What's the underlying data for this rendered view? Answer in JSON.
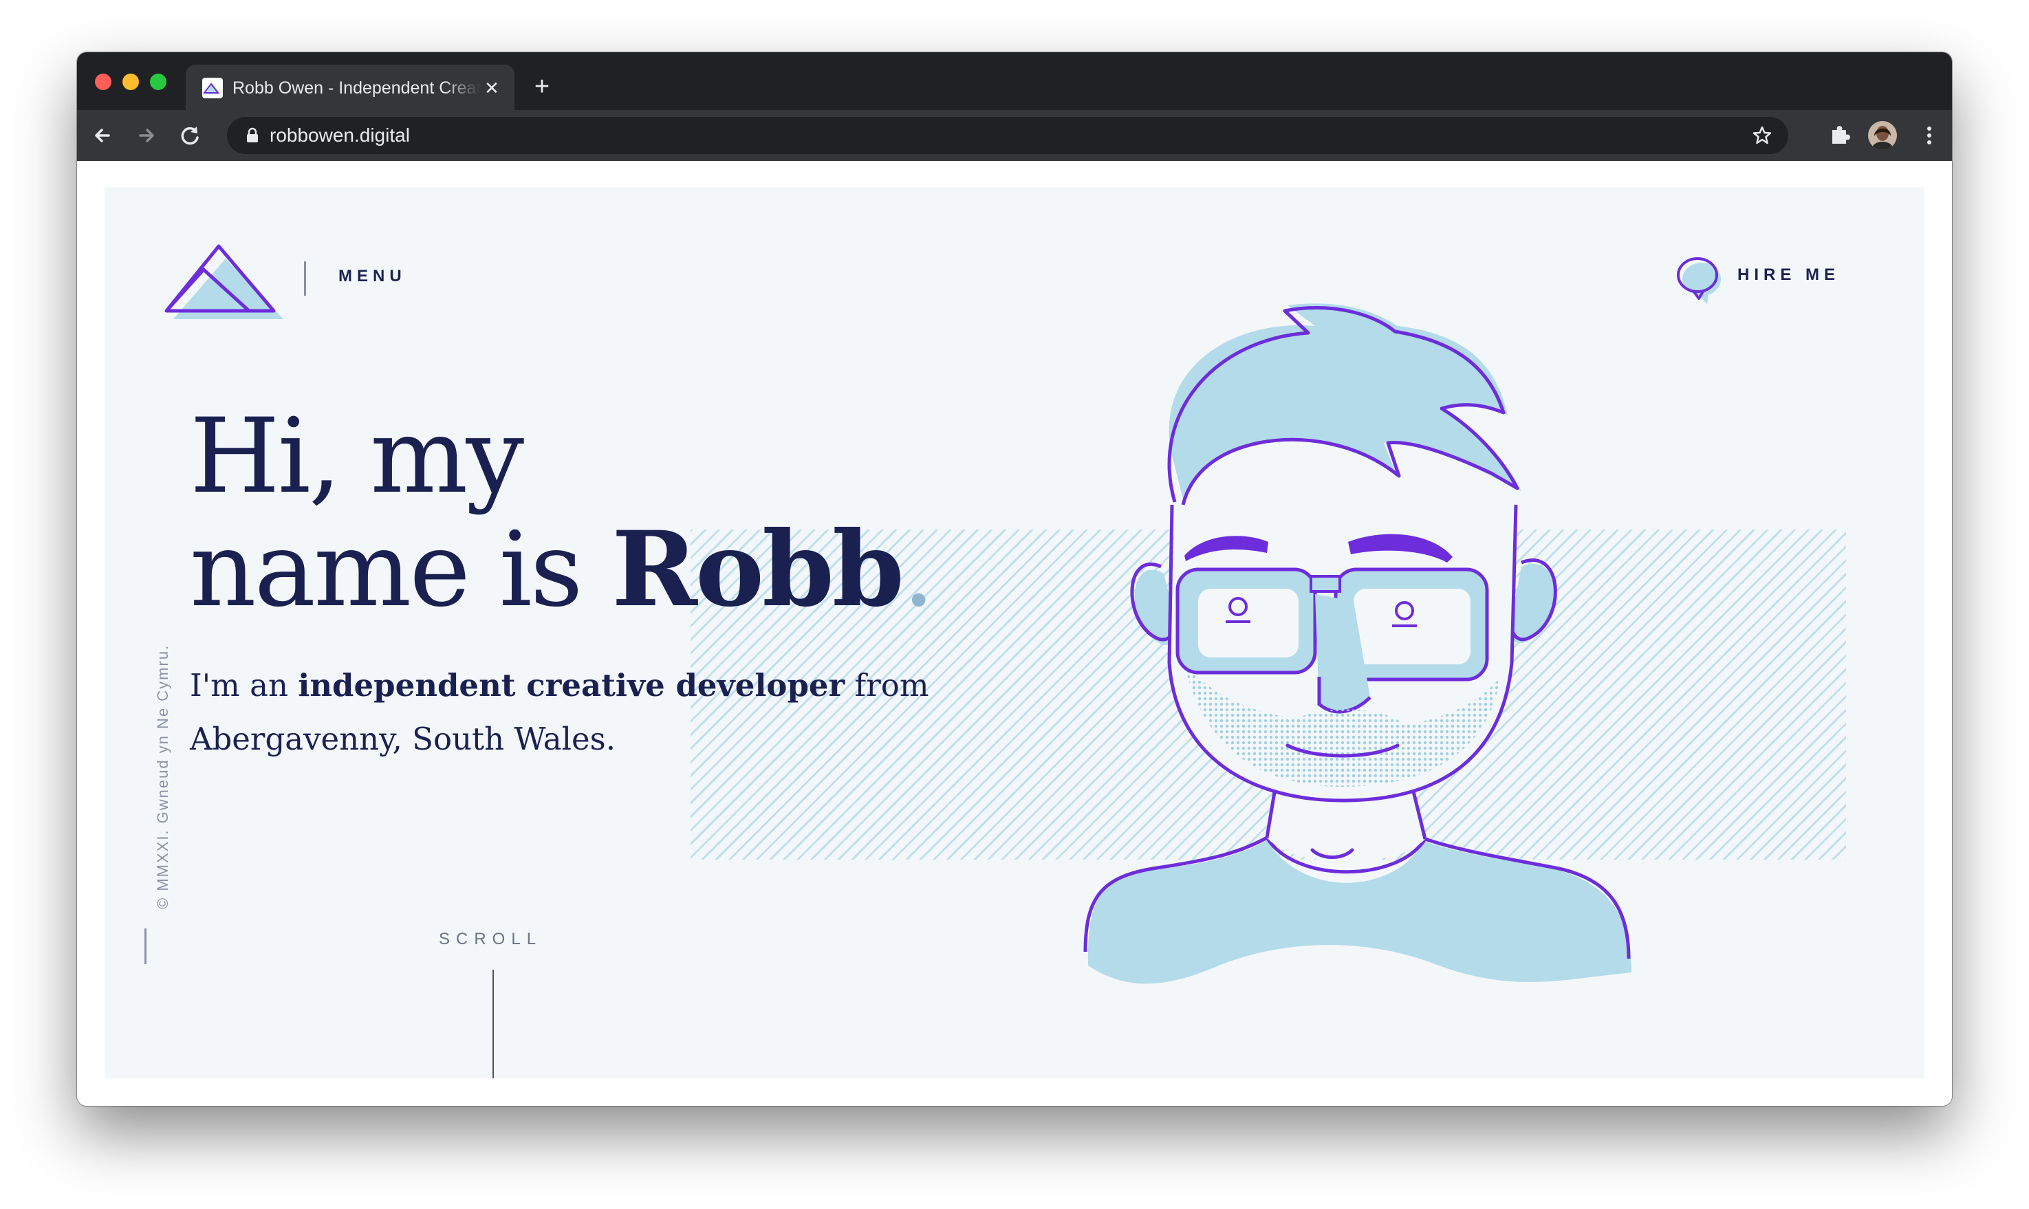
{
  "browser": {
    "tab_title": "Robb Owen - Independent Creative Developer",
    "tab_close": "✕",
    "new_tab": "+",
    "url": "robbowen.digital"
  },
  "page": {
    "menu_label": "MENU",
    "hire_label": "HIRE ME",
    "headline": {
      "line1": "Hi, my",
      "line2_prefix": "name is ",
      "name": "Robb",
      "dot": "."
    },
    "intro": {
      "prefix": "I'm an ",
      "emphasis": "independent creative developer",
      "suffix": " from Abergavenny, South Wales."
    },
    "copyright": "© MMXXI. Gwneud yn Ne Cymru.",
    "scroll_label": "SCROLL"
  },
  "colors": {
    "navy": "#1a2151",
    "purple": "#6d2ddb",
    "light_blue": "#b3dbea",
    "page_bg": "#f4f7fa"
  }
}
